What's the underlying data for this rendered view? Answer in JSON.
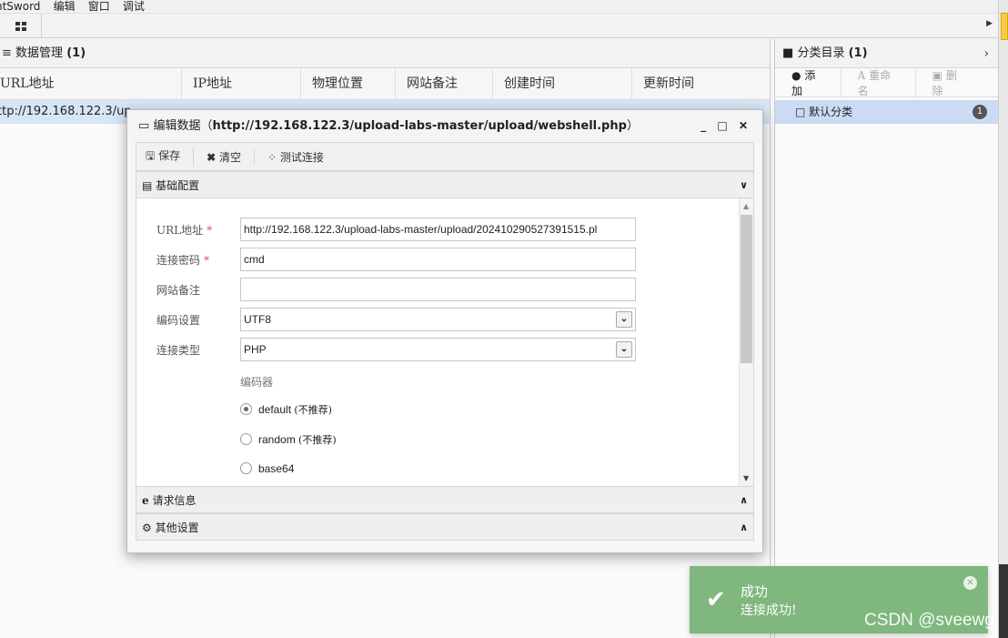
{
  "menubar": {
    "items": [
      "ntSword",
      "编辑",
      "窗口",
      "调试"
    ]
  },
  "left_panel": {
    "title": "数据管理",
    "count": "(1)",
    "columns": [
      "URL地址",
      "IP地址",
      "物理位置",
      "网站备注",
      "创建时间",
      "更新时间"
    ],
    "rows": [
      {
        "url": "ttp://192.168.122.3/up"
      }
    ]
  },
  "right_panel": {
    "title": "分类目录",
    "count": "(1)",
    "tools": {
      "add": "添加",
      "rename": "重命名",
      "delete": "删除"
    },
    "category": {
      "name": "默认分类",
      "count": "1"
    }
  },
  "dialog": {
    "title_prefix": "编辑数据（",
    "title_url": "http://192.168.122.3/upload-labs-master/upload/webshell.php",
    "title_suffix": "）",
    "controls": "_ □ ✕",
    "toolbar": {
      "save": "保存",
      "clear": "清空",
      "test": "测试连接"
    },
    "sections": {
      "basic": "基础配置",
      "request": "请求信息",
      "other": "其他设置"
    },
    "form": {
      "url_label": "URL地址",
      "url_value": "http://192.168.122.3/upload-labs-master/upload/202410290527391515.pl",
      "password_label": "连接密码",
      "password_value": "cmd",
      "note_label": "网站备注",
      "note_value": "",
      "encoding_label": "编码设置",
      "encoding_value": "UTF8",
      "type_label": "连接类型",
      "type_value": "PHP",
      "encoder_label": "编码器",
      "encoders": [
        {
          "name": "default",
          "note": "(不推荐)",
          "selected": true
        },
        {
          "name": "random",
          "note": "(不推荐)",
          "selected": false
        },
        {
          "name": "base64",
          "note": "",
          "selected": false
        }
      ]
    }
  },
  "toast": {
    "title": "成功",
    "message": "连接成功!"
  },
  "watermark": "CSDN @sveewg",
  "colors": {
    "selection": "#d7e6f7",
    "toast": "#7fb77e",
    "required": "#d9534f"
  }
}
